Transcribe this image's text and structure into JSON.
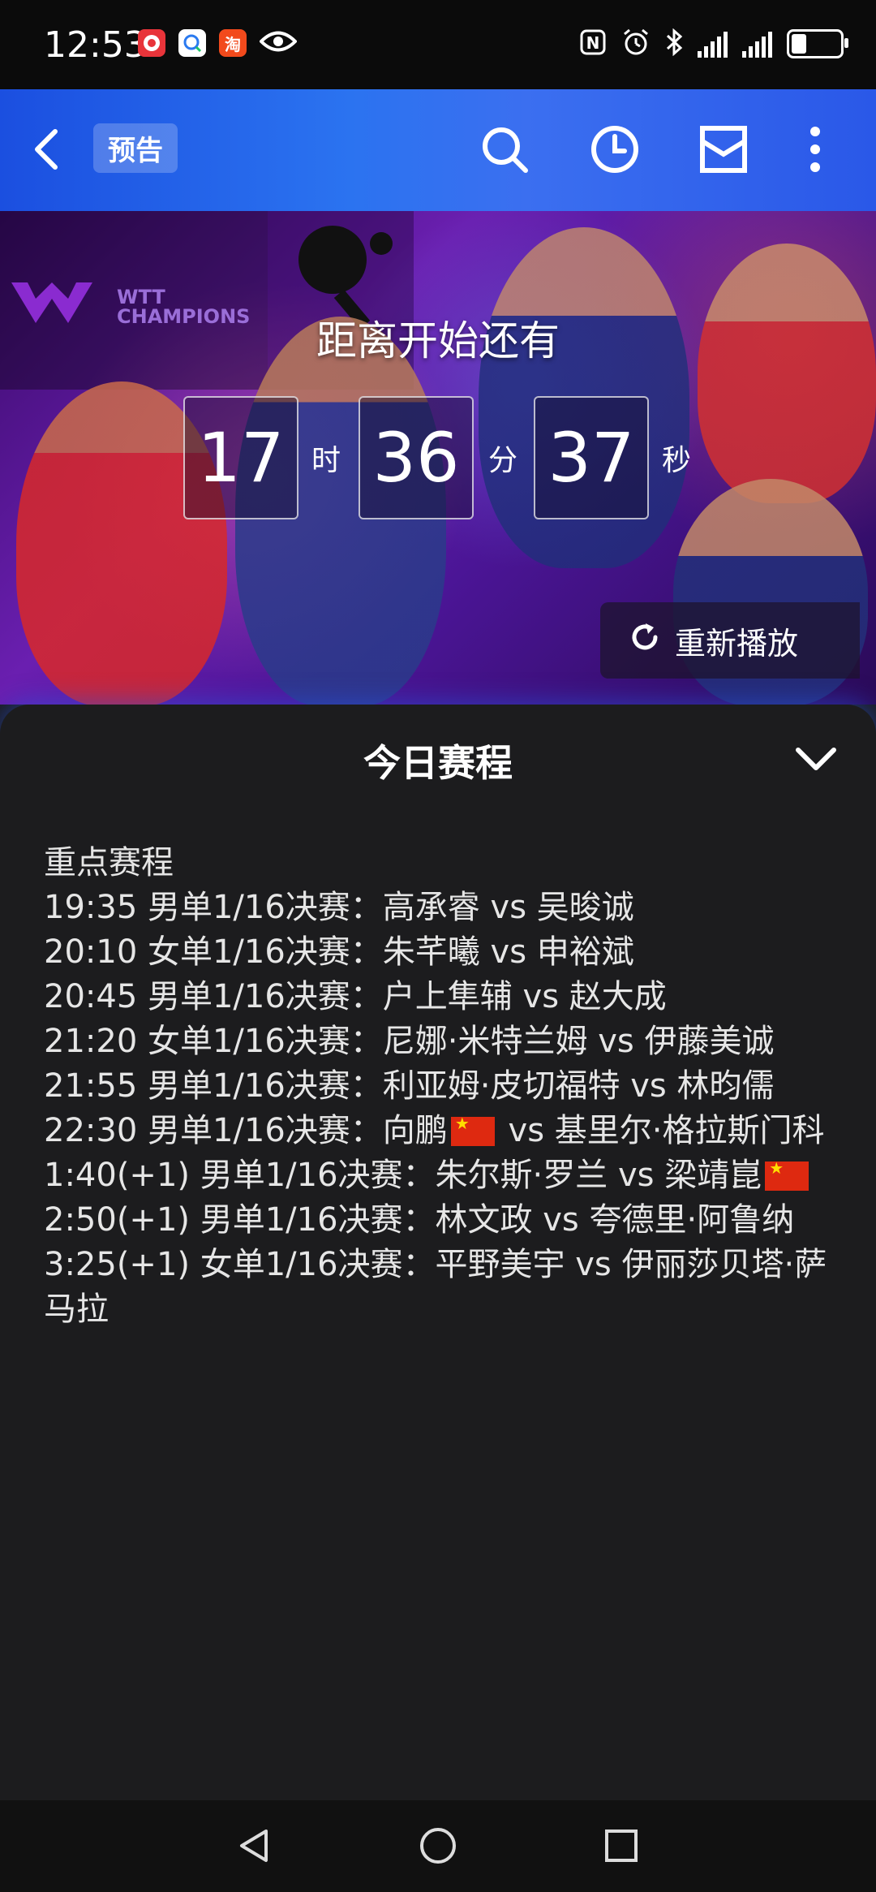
{
  "status_bar": {
    "time": "12:53",
    "app_icons": [
      "lucky-app-icon",
      "search-app-icon",
      "taobao-app-icon",
      "eye-icon"
    ],
    "taobao_label": "淘",
    "right_icons": [
      "nfc-icon",
      "alarm-icon",
      "bluetooth-icon",
      "signal-icon",
      "signal-icon",
      "battery-icon"
    ]
  },
  "top_nav": {
    "tag": "预告",
    "icons": [
      "back-icon",
      "search-icon",
      "history-icon",
      "inbox-icon",
      "more-icon"
    ]
  },
  "video": {
    "logo_text": "WTT CHAMPIONS",
    "countdown_title": "距离开始还有",
    "hours": "17",
    "hours_unit": "时",
    "minutes": "36",
    "minutes_unit": "分",
    "seconds": "37",
    "seconds_unit": "秒",
    "replay_label": "重新播放"
  },
  "sheet": {
    "title": "今日赛程",
    "heading": "重点赛程",
    "lines": [
      {
        "before": "19:35 男单1/16决赛：高承睿 vs 吴晙诚",
        "flag": false,
        "after": ""
      },
      {
        "before": "20:10 女单1/16决赛：朱芊曦 vs 申裕斌",
        "flag": false,
        "after": ""
      },
      {
        "before": "20:45 男单1/16决赛：户上隼辅 vs 赵大成",
        "flag": false,
        "after": ""
      },
      {
        "before": "21:20 女单1/16决赛：尼娜·米特兰姆 vs 伊藤美诚",
        "flag": false,
        "after": ""
      },
      {
        "before": "21:55 男单1/16决赛：利亚姆·皮切福特 vs 林昀儒",
        "flag": false,
        "after": ""
      },
      {
        "before": "22:30 男单1/16决赛：向鹏",
        "flag": true,
        "after": " vs 基里尔·格拉斯门科"
      },
      {
        "before": "1:40(+1) 男单1/16决赛：朱尔斯·罗兰 vs 梁靖崑",
        "flag": true,
        "after": ""
      },
      {
        "before": "2:50(+1) 男单1/16决赛：林文政 vs 夸德里·阿鲁纳",
        "flag": false,
        "after": ""
      },
      {
        "before": "3:25(+1) 女单1/16决赛：平野美宇 vs 伊丽莎贝塔·萨马拉",
        "flag": false,
        "after": ""
      }
    ]
  },
  "nav_bar": {
    "icons": [
      "back-triangle-icon",
      "home-circle-icon",
      "recents-square-icon"
    ]
  }
}
